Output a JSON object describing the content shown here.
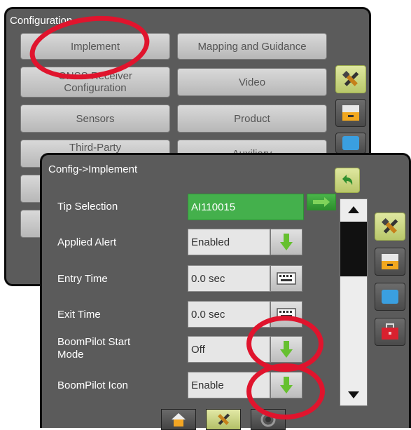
{
  "back_panel": {
    "title": "Configuration",
    "buttons": {
      "implement": "Implement",
      "mapping": "Mapping and Guidance",
      "gnss": "GNSS Receiver Configuration",
      "video": "Video",
      "sensors": "Sensors",
      "product": "Product",
      "third_party": "Third-Party",
      "third_party_right": "Auxiliary"
    },
    "side_tabs": [
      "tools-icon",
      "console-icon",
      "screen-icon"
    ]
  },
  "front_panel": {
    "title": "Config->Implement",
    "rows": [
      {
        "label": "Tip Selection",
        "value": "AI110015",
        "control": "arrow-right-icon"
      },
      {
        "label": "Applied Alert",
        "value": "Enabled",
        "control": "arrow-down-icon"
      },
      {
        "label": "Entry Time",
        "value": "0.0 sec",
        "control": "keyboard-icon"
      },
      {
        "label": "Exit Time",
        "value": "0.0 sec",
        "control": "keyboard-icon"
      },
      {
        "label": "BoomPilot Start Mode",
        "value": "Off",
        "control": "arrow-down-icon"
      },
      {
        "label": "BoomPilot Icon",
        "value": "Enable",
        "control": "arrow-down-icon"
      }
    ],
    "side_tabs": [
      "tools-icon",
      "console-icon",
      "screen-icon",
      "toolbox-icon"
    ],
    "bottom_tabs": [
      "home-icon",
      "tools-icon",
      "gps-icon"
    ]
  },
  "colors": {
    "panel_bg": "#5b5b5b",
    "highlight_ring": "#e0142d",
    "green_field": "#44b04c",
    "green_arrow": "#66c02f"
  }
}
